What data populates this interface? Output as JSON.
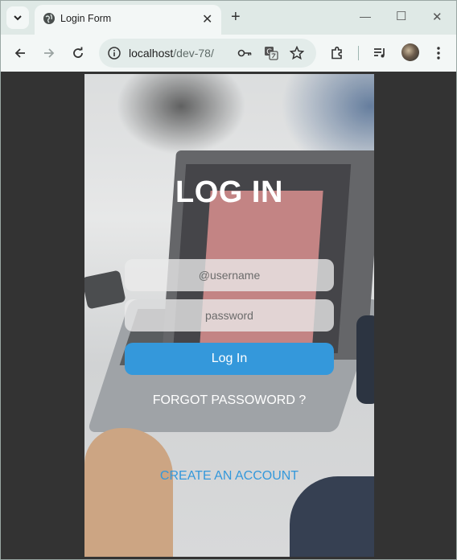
{
  "browser": {
    "tab_title": "Login Form",
    "url_host": "localhost",
    "url_path": "/dev-78/"
  },
  "icons": {
    "tab_search": "chevron-down-icon",
    "favicon": "globe-icon",
    "tab_close": "close-icon",
    "new_tab": "plus-icon",
    "back": "arrow-left-icon",
    "forward": "arrow-right-icon",
    "reload": "reload-icon",
    "site_info": "info-icon",
    "password_key": "key-icon",
    "translate": "translate-icon",
    "bookmark": "star-icon",
    "extensions": "puzzle-icon",
    "media": "playlist-icon",
    "profile": "avatar",
    "menu": "more-vertical-icon"
  },
  "login": {
    "title": "LOG IN",
    "username_placeholder": "@username",
    "password_placeholder": "password",
    "login_button": "Log In",
    "forgot_link": "FORGOT PASSOWORD ?",
    "create_link": "CREATE AN ACCOUNT"
  },
  "colors": {
    "accent": "#3498db",
    "page_background": "#333333",
    "title_text": "#ffffff"
  }
}
